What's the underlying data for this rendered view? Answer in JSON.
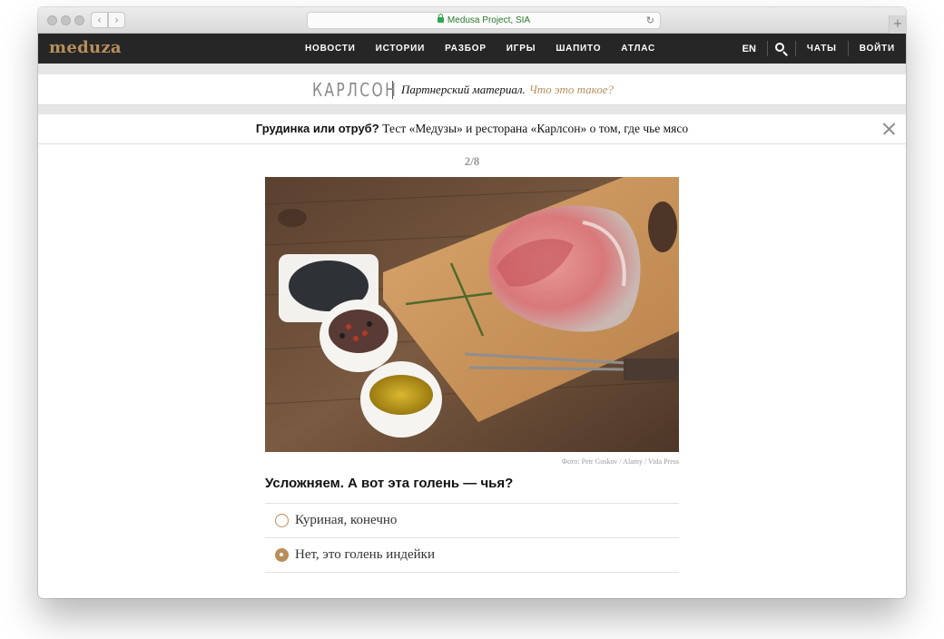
{
  "browser": {
    "url_text": "Medusa Project, SIA"
  },
  "site": {
    "logo": "meduza",
    "nav": [
      "НОВОСТИ",
      "ИСТОРИИ",
      "РАЗБОР",
      "ИГРЫ",
      "ШАПИТО",
      "АТЛАС"
    ],
    "lang": "EN",
    "chats": "ЧАТЫ",
    "login": "ВОЙТИ"
  },
  "partner": {
    "brand": "КАРЛСОН",
    "label": "Партнерский материал.",
    "link": "Что это такое?"
  },
  "quiz": {
    "title_bold": "Грудинка или отруб?",
    "title_rest": "Тест «Медузы» и ресторана «Карлсон» о том, где чье мясо",
    "counter": "2/8",
    "photo_credit": "Фото: Petr Goskov / Alamy / Vida Press",
    "question": "Усложняем. А вот эта голень — чья?",
    "answers": [
      {
        "text": "Куриная, конечно",
        "selected": false
      },
      {
        "text": "Нет, это голень индейки",
        "selected": true
      }
    ]
  },
  "colors": {
    "accent": "#b88e5b",
    "nav_bg": "#262626"
  }
}
